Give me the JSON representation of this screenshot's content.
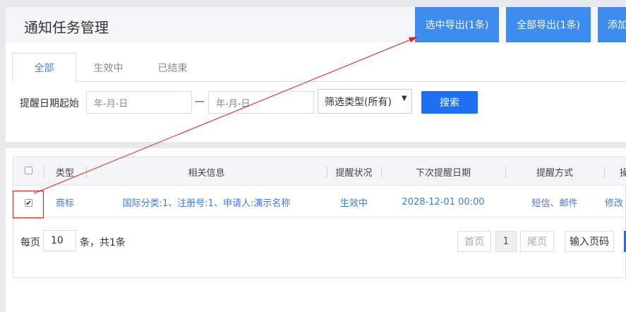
{
  "header": {
    "title": "通知任务管理",
    "export_selected": "选中导出(1条)",
    "export_all": "全部导出(1条)",
    "add": "添加"
  },
  "tabs": [
    {
      "label": "全部",
      "active": true
    },
    {
      "label": "生效中",
      "active": false
    },
    {
      "label": "已结束",
      "active": false
    }
  ],
  "filter": {
    "date_label": "提醒日期起始",
    "date_start_placeholder": "年-月-日",
    "date_separator": "—",
    "date_end_placeholder": "年-月-日",
    "type_selected": "筛选类型(所有)",
    "search_label": "搜索"
  },
  "table": {
    "columns": [
      "类型",
      "相关信息",
      "提醒状况",
      "下次提醒日期",
      "提醒方式",
      "操作"
    ],
    "rows": [
      {
        "checked": true,
        "type": "商标",
        "info": "国际分类:1、注册号:1、申请人:演示名称",
        "status": "生效中",
        "next_date": "2028-12-01 00:00",
        "method": "短信、邮件",
        "action": "修改"
      }
    ]
  },
  "pagination": {
    "per_page_label": "每页",
    "per_page_value": "10",
    "total_label": "条，共1条",
    "first": "首页",
    "current": "1",
    "last": "尾页",
    "goto_placeholder": "输入页码"
  },
  "colors": {
    "primary": "#3d8cf0",
    "search": "#1e6ff1",
    "link": "#3d7bd9",
    "annotation": "#e02020"
  }
}
